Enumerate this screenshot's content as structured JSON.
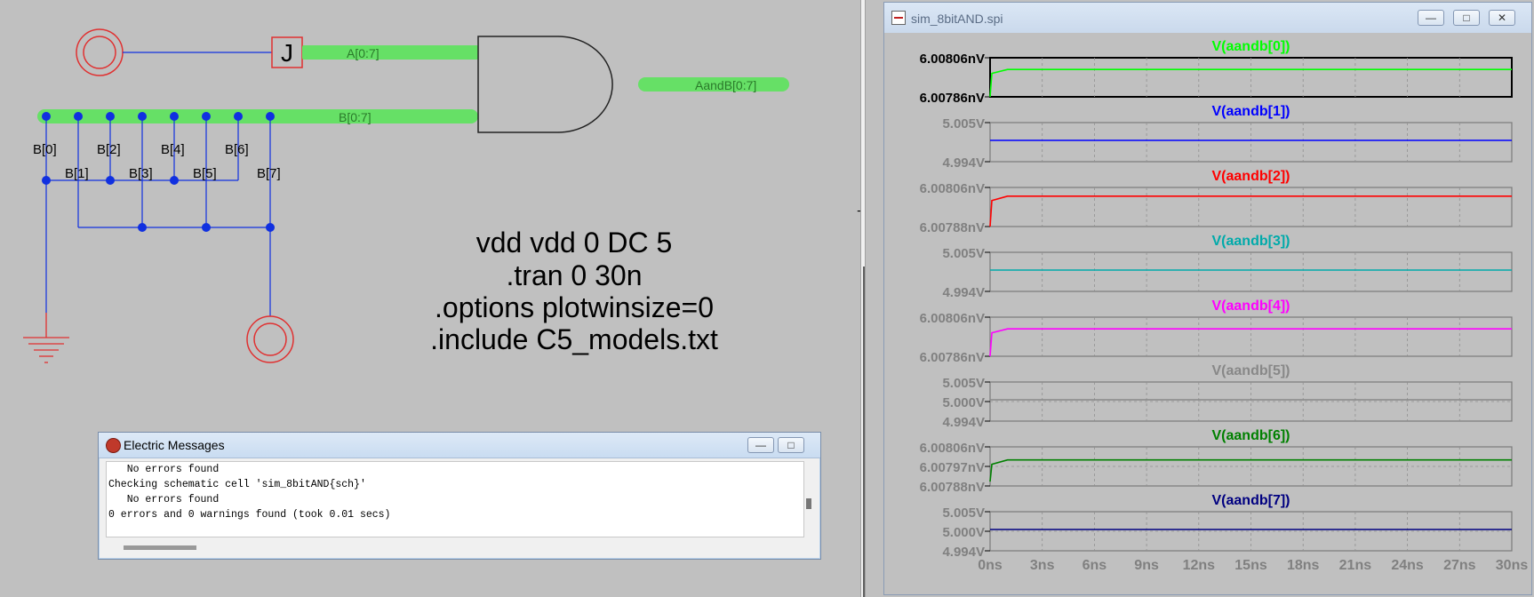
{
  "schematic": {
    "bus_a_label": "A[0:7]",
    "bus_b_label": "B[0:7]",
    "bus_out_label": "AandB[0:7]",
    "source_letter": "J",
    "taps_row1": [
      "B[0]",
      "B[2]",
      "B[4]",
      "B[6]"
    ],
    "taps_row2": [
      "B[1]",
      "B[3]",
      "B[5]",
      "B[7]"
    ],
    "spice_lines": [
      "vdd vdd 0 DC 5",
      ".tran 0 30n",
      ".options plotwinsize=0",
      ".include C5_models.txt"
    ]
  },
  "messages_window": {
    "title": "Electric Messages",
    "lines": [
      "   No errors found",
      "Checking schematic cell 'sim_8bitAND{sch}'",
      "   No errors found",
      "0 errors and 0 warnings found (took 0.01 secs)"
    ]
  },
  "plot_window": {
    "title": "sim_8bitAND.spi",
    "x_ticks": [
      "0ns",
      "3ns",
      "6ns",
      "9ns",
      "12ns",
      "15ns",
      "18ns",
      "21ns",
      "24ns",
      "27ns",
      "30ns"
    ]
  },
  "chart_data": [
    {
      "type": "line",
      "title": "V(aandb[0])",
      "color": "#00ff00",
      "x_range": [
        0,
        30
      ],
      "y_ticks": [
        "6.00806nV",
        "6.00786nV"
      ],
      "ylim": [
        6.00786,
        6.00806
      ],
      "series": [
        {
          "name": "V(aandb[0])",
          "x": [
            0,
            0.1,
            1,
            30
          ],
          "y": [
            6.00786,
            6.00798,
            6.008,
            6.008
          ]
        }
      ],
      "x_unit": "ns",
      "y_unit": "nV"
    },
    {
      "type": "line",
      "title": "V(aandb[1])",
      "color": "#0000ff",
      "x_range": [
        0,
        30
      ],
      "y_ticks": [
        "5.005V",
        "4.994V"
      ],
      "ylim": [
        4.994,
        5.005
      ],
      "series": [
        {
          "name": "V(aandb[1])",
          "x": [
            0,
            30
          ],
          "y": [
            5.0,
            5.0
          ]
        }
      ],
      "x_unit": "ns",
      "y_unit": "V"
    },
    {
      "type": "line",
      "title": "V(aandb[2])",
      "color": "#ff0000",
      "x_range": [
        0,
        30
      ],
      "y_ticks": [
        "6.00806nV",
        "6.00788nV"
      ],
      "ylim": [
        6.00788,
        6.00806
      ],
      "series": [
        {
          "name": "V(aandb[2])",
          "x": [
            0,
            0.1,
            1,
            30
          ],
          "y": [
            6.00788,
            6.008,
            6.00802,
            6.00802
          ]
        }
      ],
      "x_unit": "ns",
      "y_unit": "nV"
    },
    {
      "type": "line",
      "title": "V(aandb[3])",
      "color": "#00aaaa",
      "x_range": [
        0,
        30
      ],
      "y_ticks": [
        "5.005V",
        "4.994V"
      ],
      "ylim": [
        4.994,
        5.005
      ],
      "series": [
        {
          "name": "V(aandb[3])",
          "x": [
            0,
            30
          ],
          "y": [
            5.0,
            5.0
          ]
        }
      ],
      "x_unit": "ns",
      "y_unit": "V"
    },
    {
      "type": "line",
      "title": "V(aandb[4])",
      "color": "#ff00ff",
      "x_range": [
        0,
        30
      ],
      "y_ticks": [
        "6.00806nV",
        "6.00786nV"
      ],
      "ylim": [
        6.00786,
        6.00806
      ],
      "series": [
        {
          "name": "V(aandb[4])",
          "x": [
            0,
            0.1,
            1,
            30
          ],
          "y": [
            6.00786,
            6.00798,
            6.008,
            6.008
          ]
        }
      ],
      "x_unit": "ns",
      "y_unit": "nV"
    },
    {
      "type": "line",
      "title": "V(aandb[5])",
      "color": "#888888",
      "x_range": [
        0,
        30
      ],
      "y_ticks": [
        "5.005V",
        "5.000V",
        "4.994V"
      ],
      "ylim": [
        4.994,
        5.005
      ],
      "series": [
        {
          "name": "V(aandb[5])",
          "x": [
            0,
            30
          ],
          "y": [
            5.0,
            5.0
          ]
        }
      ],
      "x_unit": "ns",
      "y_unit": "V"
    },
    {
      "type": "line",
      "title": "V(aandb[6])",
      "color": "#008000",
      "x_range": [
        0,
        30
      ],
      "y_ticks": [
        "6.00806nV",
        "6.00797nV",
        "6.00788nV"
      ],
      "ylim": [
        6.00788,
        6.00806
      ],
      "series": [
        {
          "name": "V(aandb[6])",
          "x": [
            0,
            0.1,
            1,
            30
          ],
          "y": [
            6.0079,
            6.00798,
            6.008,
            6.008
          ]
        }
      ],
      "x_unit": "ns",
      "y_unit": "nV"
    },
    {
      "type": "line",
      "title": "V(aandb[7])",
      "color": "#000080",
      "x_range": [
        0,
        30
      ],
      "y_ticks": [
        "5.005V",
        "5.000V",
        "4.994V"
      ],
      "ylim": [
        4.994,
        5.005
      ],
      "series": [
        {
          "name": "V(aandb[7])",
          "x": [
            0,
            30
          ],
          "y": [
            5.0,
            5.0
          ]
        }
      ],
      "x_unit": "ns",
      "y_unit": "V"
    }
  ]
}
